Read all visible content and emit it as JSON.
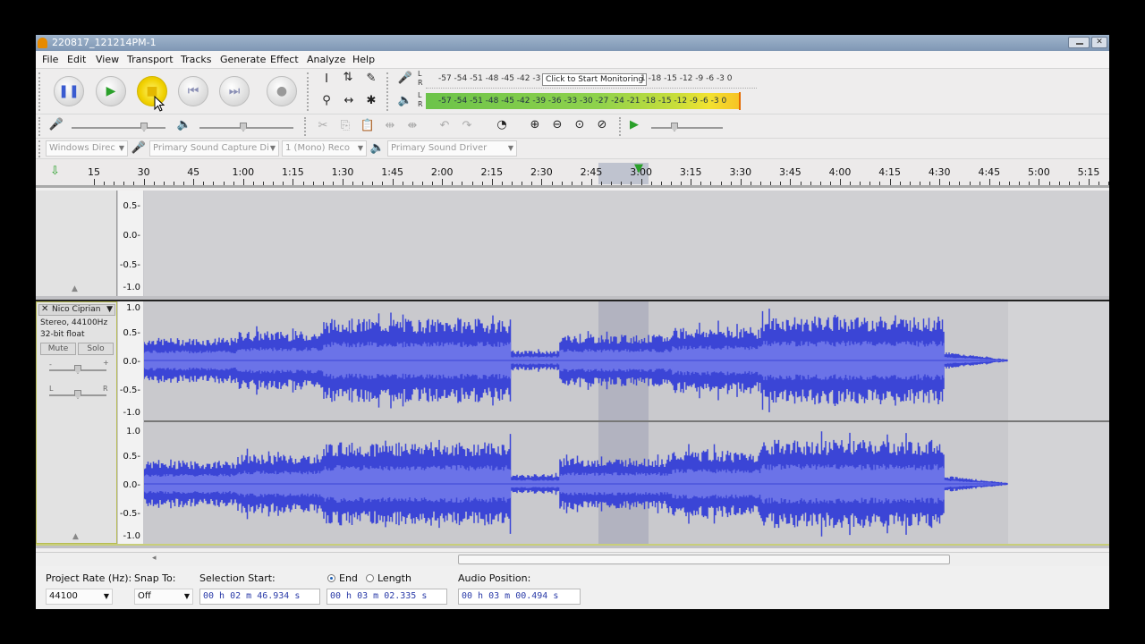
{
  "window": {
    "title": "220817_121214PM-1"
  },
  "menu": [
    "File",
    "Edit",
    "View",
    "Transport",
    "Tracks",
    "Generate",
    "Effect",
    "Analyze",
    "Help"
  ],
  "meters": {
    "record_scale": "-57 -54 -51 -48 -45 -42 -3",
    "record_scale_right": "1 -18 -15 -12  -9  -6  -3  0",
    "monitor_tooltip": "Click to Start Monitoring",
    "playback_scale": "-57 -54 -51 -48 -45 -42 -39 -36 -33 -30 -27 -24 -21 -18 -15 -12  -9  -6  -3  0",
    "channel_L": "L",
    "channel_R": "R"
  },
  "devices": {
    "host": "Windows Direc",
    "recording_device": "Primary Sound Capture Di",
    "channels": "1 (Mono) Reco",
    "playback_device": "Primary Sound Driver"
  },
  "ruler": {
    "labels": [
      "15",
      "30",
      "45",
      "1:00",
      "1:15",
      "1:30",
      "1:45",
      "2:00",
      "2:15",
      "2:30",
      "2:45",
      "3:00",
      "3:15",
      "3:30",
      "3:45",
      "4:00",
      "4:15",
      "4:30",
      "4:45",
      "5:00",
      "5:15"
    ]
  },
  "empty_track": {
    "scale": [
      "0.5-",
      "0.0-",
      "-0.5-",
      "-1.0"
    ]
  },
  "audio_track": {
    "name": "Nico Ciprian",
    "format": "Stereo, 44100Hz",
    "bit_depth": "32-bit float",
    "mute": "Mute",
    "solo": "Solo",
    "gain_minus": "-",
    "gain_plus": "+",
    "pan_left": "L",
    "pan_right": "R",
    "scale": [
      "1.0",
      "0.5-",
      "0.0-",
      "-0.5-",
      "-1.0"
    ]
  },
  "selection_bar": {
    "project_rate_label": "Project Rate (Hz):",
    "project_rate": "44100",
    "snap_label": "Snap To:",
    "snap_value": "Off",
    "selection_start_label": "Selection Start:",
    "selection_start": "00 h 02 m 46.934 s",
    "end_label": "End",
    "length_label": "Length",
    "end_value": "00 h 03 m 02.335 s",
    "audio_position_label": "Audio Position:",
    "audio_position": "00 h 03 m 00.494 s"
  },
  "colors": {
    "waveform": "#3b45d6",
    "waveform_rms": "#6b73e8",
    "selection": "#b2b3c0",
    "meter_green": "#6cc34a"
  },
  "icons": {
    "pause": "pause-icon",
    "play": "play-icon",
    "stop": "stop-icon",
    "skip_start": "skip-start-icon",
    "skip_end": "skip-end-icon",
    "record": "record-icon"
  }
}
